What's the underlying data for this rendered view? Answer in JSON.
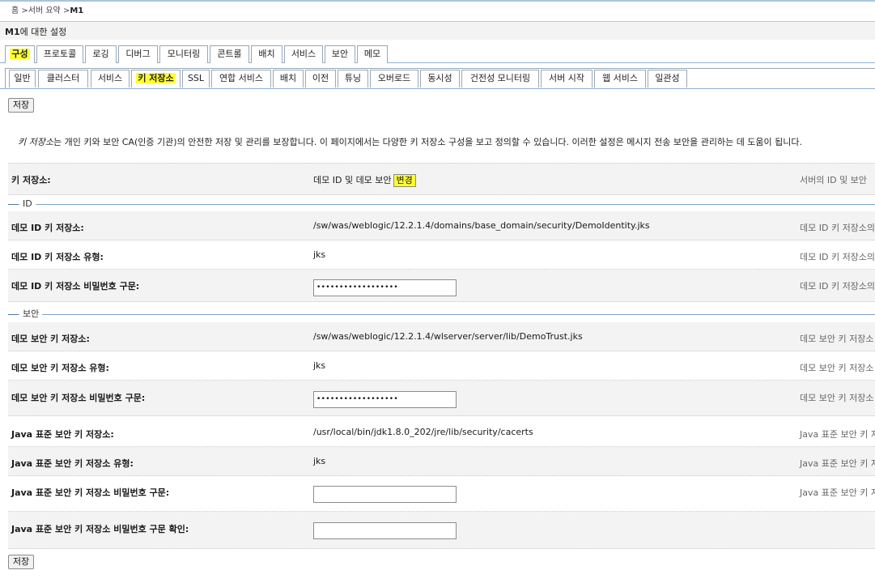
{
  "breadcrumb": {
    "home": "홈",
    "sep": ">",
    "summary": "서버 요약",
    "current": "M1"
  },
  "title": {
    "server": "M1",
    "suffix": "에 대한 설정"
  },
  "main_tabs": [
    {
      "label": "구성",
      "active": true
    },
    {
      "label": "프로토콜"
    },
    {
      "label": "로깅"
    },
    {
      "label": "디버그"
    },
    {
      "label": "모니터링"
    },
    {
      "label": "콘트롤"
    },
    {
      "label": "배치"
    },
    {
      "label": "서비스"
    },
    {
      "label": "보안"
    },
    {
      "label": "메모"
    }
  ],
  "sub_tabs": [
    {
      "label": "일반"
    },
    {
      "label": "클러스터"
    },
    {
      "label": "서비스"
    },
    {
      "label": "키 저장소",
      "active": true
    },
    {
      "label": "SSL"
    },
    {
      "label": "연합 서비스"
    },
    {
      "label": "배치"
    },
    {
      "label": "이전"
    },
    {
      "label": "튜닝"
    },
    {
      "label": "오버로드"
    },
    {
      "label": "동시성"
    },
    {
      "label": "건전성 모니터링"
    },
    {
      "label": "서버 시작"
    },
    {
      "label": "웹 서비스"
    },
    {
      "label": "일관성"
    }
  ],
  "save_label": "저장",
  "description": {
    "term": "키 저장소",
    "text": "는 개인 키와 보안 CA(인증 기관)의 안전한 저장 및 관리를 보장합니다. 이 페이지에서는 다양한 키 저장소 구성을 보고 정의할 수 있습니다. 이러한 설정은 메시지 전송 보안을 관리하는 데 도움이 됩니다."
  },
  "keystores": {
    "label": "키 저장소:",
    "value": "데모 ID 및 데모 보안",
    "change_label": "변경",
    "help": "서버의 ID 및 보안"
  },
  "sections": {
    "identity": "ID",
    "trust": "보안"
  },
  "fields": {
    "demo_id_keystore": {
      "label": "데모 ID 키 저장소:",
      "value": "/sw/was/weblogic/12.2.1.4/domains/base_domain/security/DemoIdentity.jks",
      "help": "데모 ID 키 저장소의"
    },
    "demo_id_type": {
      "label": "데모 ID 키 저장소 유형:",
      "value": "jks",
      "help": "데모 ID 키 저장소의"
    },
    "demo_id_pass": {
      "label": "데모 ID 키 저장소 비밀번호 구문:",
      "value": "••••••••••••••••••",
      "help": "데모 ID 키 저장소의"
    },
    "demo_trust_keystore": {
      "label": "데모 보안 키 저장소:",
      "value": "/sw/was/weblogic/12.2.1.4/wlserver/server/lib/DemoTrust.jks",
      "help": "데모 보안 키 저장소"
    },
    "demo_trust_type": {
      "label": "데모 보안 키 저장소 유형:",
      "value": "jks",
      "help": "데모 보안 키 저장소"
    },
    "demo_trust_pass": {
      "label": "데모 보안 키 저장소 비밀번호 구문:",
      "value": "••••••••••••••••••",
      "help": "데모 보안 키 저장소"
    },
    "java_trust_keystore": {
      "label": "Java 표준 보안 키 저장소:",
      "value": "/usr/local/bin/jdk1.8.0_202/jre/lib/security/cacerts",
      "help": "Java 표준 보안 키 저"
    },
    "java_trust_type": {
      "label": "Java 표준 보안 키 저장소 유형:",
      "value": "jks",
      "help": "Java 표준 보안 키 저"
    },
    "java_trust_pass": {
      "label": "Java 표준 보안 키 저장소 비밀번호 구문:",
      "value": "",
      "help": "Java 표준 보안 키 저"
    },
    "java_trust_pass_confirm": {
      "label": "Java 표준 보안 키 저장소 비밀번호 구문 확인:",
      "value": ""
    }
  }
}
